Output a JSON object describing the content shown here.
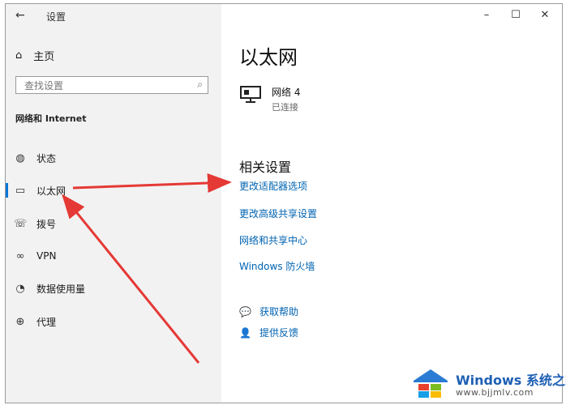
{
  "window": {
    "back_icon": "back-arrow-icon",
    "title": "设置",
    "controls": [
      "–",
      "☐",
      "✕"
    ]
  },
  "sidebar": {
    "home_label": "主页",
    "search_placeholder": "查找设置",
    "section_title": "网络和 Internet",
    "items": [
      {
        "label": "状态",
        "icon": "globe-status-icon"
      },
      {
        "label": "以太网",
        "icon": "ethernet-icon",
        "selected": true
      },
      {
        "label": "拨号",
        "icon": "dialup-icon"
      },
      {
        "label": "VPN",
        "icon": "vpn-icon"
      },
      {
        "label": "数据使用量",
        "icon": "data-usage-icon"
      },
      {
        "label": "代理",
        "icon": "globe-proxy-icon"
      }
    ]
  },
  "main": {
    "title": "以太网",
    "network": {
      "name": "网络 4",
      "status": "已连接"
    },
    "related_title": "相关设置",
    "links": [
      "更改适配器选项",
      "更改高级共享设置",
      "网络和共享中心",
      "Windows 防火墙"
    ],
    "help": [
      {
        "label": "获取帮助",
        "icon": "help-chat-icon"
      },
      {
        "label": "提供反馈",
        "icon": "feedback-icon"
      }
    ]
  },
  "annotation": {
    "arrow_color": "#e53935"
  },
  "watermark": {
    "brand": "Windows 系统之家",
    "url": "www.bjjmlv.com"
  }
}
